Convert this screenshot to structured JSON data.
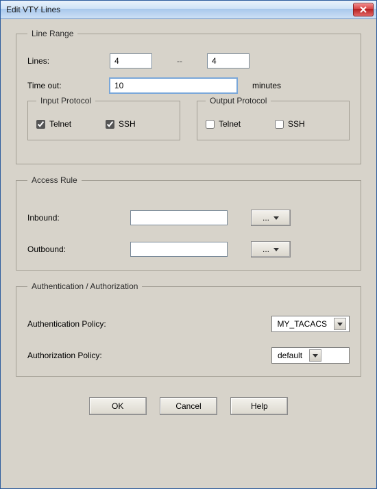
{
  "window": {
    "title": "Edit VTY Lines"
  },
  "line_range": {
    "legend": "Line Range",
    "lines_label": "Lines:",
    "lines_from": "4",
    "lines_dash": "--",
    "lines_to": "4",
    "timeout_label": "Time out:",
    "timeout_value": "10",
    "timeout_unit": "minutes",
    "input_protocol": {
      "legend": "Input Protocol",
      "telnet_label": "Telnet",
      "telnet_checked": true,
      "ssh_label": "SSH",
      "ssh_checked": true
    },
    "output_protocol": {
      "legend": "Output Protocol",
      "telnet_label": "Telnet",
      "telnet_checked": false,
      "ssh_label": "SSH",
      "ssh_checked": false
    }
  },
  "access_rule": {
    "legend": "Access Rule",
    "inbound_label": "Inbound:",
    "inbound_value": "",
    "outbound_label": "Outbound:",
    "outbound_value": "",
    "picker_label": "..."
  },
  "auth": {
    "legend": "Authentication / Authorization",
    "authn_label": "Authentication Policy:",
    "authn_value": "MY_TACACS",
    "authz_label": "Authorization Policy:",
    "authz_value": "default"
  },
  "buttons": {
    "ok": "OK",
    "cancel": "Cancel",
    "help": "Help"
  }
}
